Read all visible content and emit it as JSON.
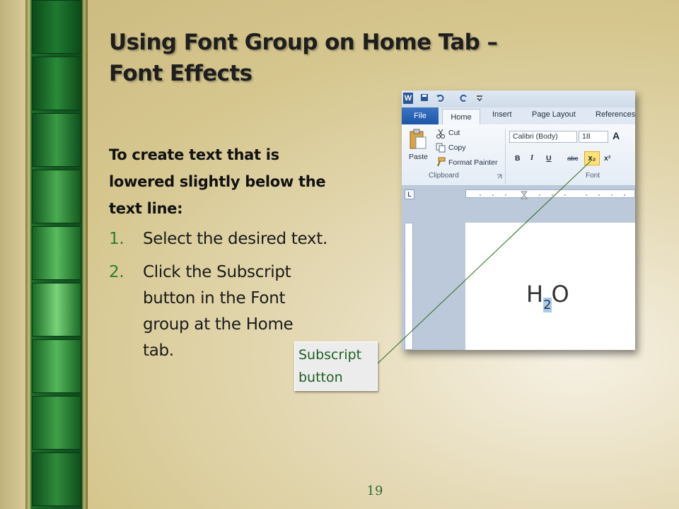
{
  "slide": {
    "title_line1": "Using Font Group on Home Tab –",
    "title_line2": "Font Effects",
    "intro": "To create text that is lowered slightly below the text line:",
    "steps": [
      {
        "num": "1.",
        "text": "Select the desired text."
      },
      {
        "num": "2.",
        "text": "Click the Subscript button in the Font group at the Home tab."
      }
    ],
    "page_number": "19"
  },
  "callout": {
    "text_line1": "Subscript",
    "text_line2": "button"
  },
  "word_screenshot": {
    "tabs": {
      "file": "File",
      "home": "Home",
      "insert": "Insert",
      "page_layout": "Page Layout",
      "references": "References"
    },
    "clipboard": {
      "paste": "Paste",
      "cut": "Cut",
      "copy": "Copy",
      "format_painter": "Format Painter",
      "group_label": "Clipboard"
    },
    "font": {
      "font_name": "Calibri (Body)",
      "font_size": "18",
      "group_label": "Font",
      "bold": "B",
      "italic": "I",
      "underline": "U",
      "strikethrough": "abc",
      "subscript": "x₂",
      "superscript": "x²",
      "grow": "A",
      "tab_selector": "L"
    },
    "document": {
      "h": "H",
      "sub": "2",
      "o": "O"
    },
    "colors": {
      "file_tab": "#1c56a8",
      "subscript_highlight": "#ffe27a",
      "selection": "#a9cbef"
    }
  },
  "background": {
    "strip_green": "#0e4a1d"
  }
}
